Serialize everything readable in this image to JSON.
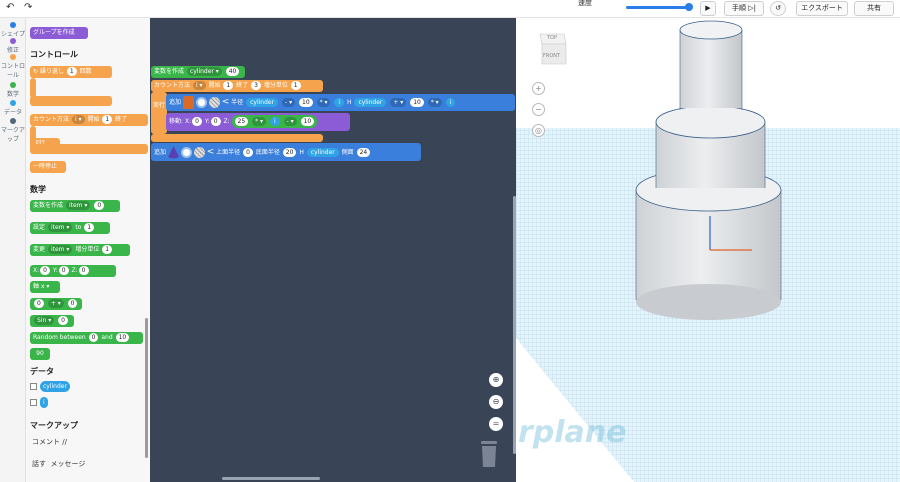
{
  "topbar": {
    "undo_icon": "undo-icon",
    "redo_icon": "redo-icon",
    "speed_label": "速度",
    "play_icon": "play-icon",
    "step_label": "手順",
    "step_icon": "step-icon",
    "reset_icon": "reset-icon",
    "export_label": "エクスポート",
    "share_label": "共有"
  },
  "categories": [
    {
      "label": "シェイプ",
      "color": "#2b7de9"
    },
    {
      "label": "修正",
      "color": "#8b5cd6"
    },
    {
      "label": "コントロール",
      "color": "#f5a34c"
    },
    {
      "label": "数学",
      "color": "#3ab54a"
    },
    {
      "label": "データ",
      "color": "#2fa3e6"
    },
    {
      "label": "マークアップ",
      "color": "#556677"
    }
  ],
  "palette": {
    "group_create": "グループを作成",
    "control_title": "コントロール",
    "repeat": {
      "label": "繰り返し",
      "count": "1",
      "suffix": "回数"
    },
    "count": {
      "label": "カウント方法",
      "var": "i",
      "start_label": "開始",
      "start": "1",
      "end_label": "終了"
    },
    "do_label": "実行",
    "pause": "一時停止",
    "math_title": "数学",
    "create_var": {
      "label": "変数を作成",
      "var": "item",
      "value": "0"
    },
    "set_var": {
      "label": "設定",
      "var": "item",
      "to": "to",
      "value": "1"
    },
    "change_var": {
      "label": "変更",
      "var": "item",
      "inc_label": "増分単位",
      "value": "1"
    },
    "xyz": {
      "x": "X:",
      "xv": "0",
      "y": "Y:",
      "yv": "0",
      "z": "Z:",
      "zv": "0"
    },
    "axis": {
      "label": "軸",
      "value": "x"
    },
    "arith": {
      "a": "0",
      "op": "+",
      "b": "0"
    },
    "sin": {
      "label": "Sin",
      "value": "0"
    },
    "random": {
      "label": "Random between",
      "a": "0",
      "and": "and",
      "b": "10"
    },
    "num90": "90",
    "data_title": "データ",
    "data_vars": [
      "cylinder",
      "i"
    ],
    "markup_title": "マークアップ",
    "comment": "コメント //",
    "say": "話す",
    "message": "メッセージ"
  },
  "workspace": {
    "b1": {
      "label": "変数を作成",
      "var": "cylinder",
      "value": "40"
    },
    "b2": {
      "label": "カウント方法",
      "var": "i",
      "start_label": "開始",
      "start": "1",
      "end_label": "終了",
      "end": "3",
      "inc_label": "増分単位",
      "inc": "1"
    },
    "do_label": "実行",
    "b3": {
      "label": "追加",
      "arrow": "<",
      "radius_label": "半径",
      "v1": "cylinder",
      "op1": "-",
      "n1": "10",
      "op2": "*",
      "v2": "i",
      "h_label": "H",
      "v3": "cylinder",
      "op3": "+",
      "n2": "10",
      "op4": "*",
      "v4": "i"
    },
    "b4": {
      "label": "移動:",
      "x": "X:",
      "xv": "0",
      "y": "Y:",
      "yv": "0",
      "z": "Z:",
      "zv": "25",
      "op": "*",
      "v": "i",
      "op2": "-",
      "n": "10"
    },
    "b5": {
      "label": "追加",
      "arrow": "<",
      "top_label": "上面半径",
      "top": "0",
      "bottom_label": "底面半径",
      "bottom": "20",
      "h_label": "H",
      "hv": "cylinder",
      "side_label": "側面",
      "side": "24"
    }
  },
  "viewcube": {
    "top": "TOP",
    "front": "FRONT"
  },
  "viewport": {
    "watermark": "rplane"
  },
  "colors": {
    "workspace": "#394457",
    "grid": "#b9def0",
    "shape": "#d8dadc"
  }
}
